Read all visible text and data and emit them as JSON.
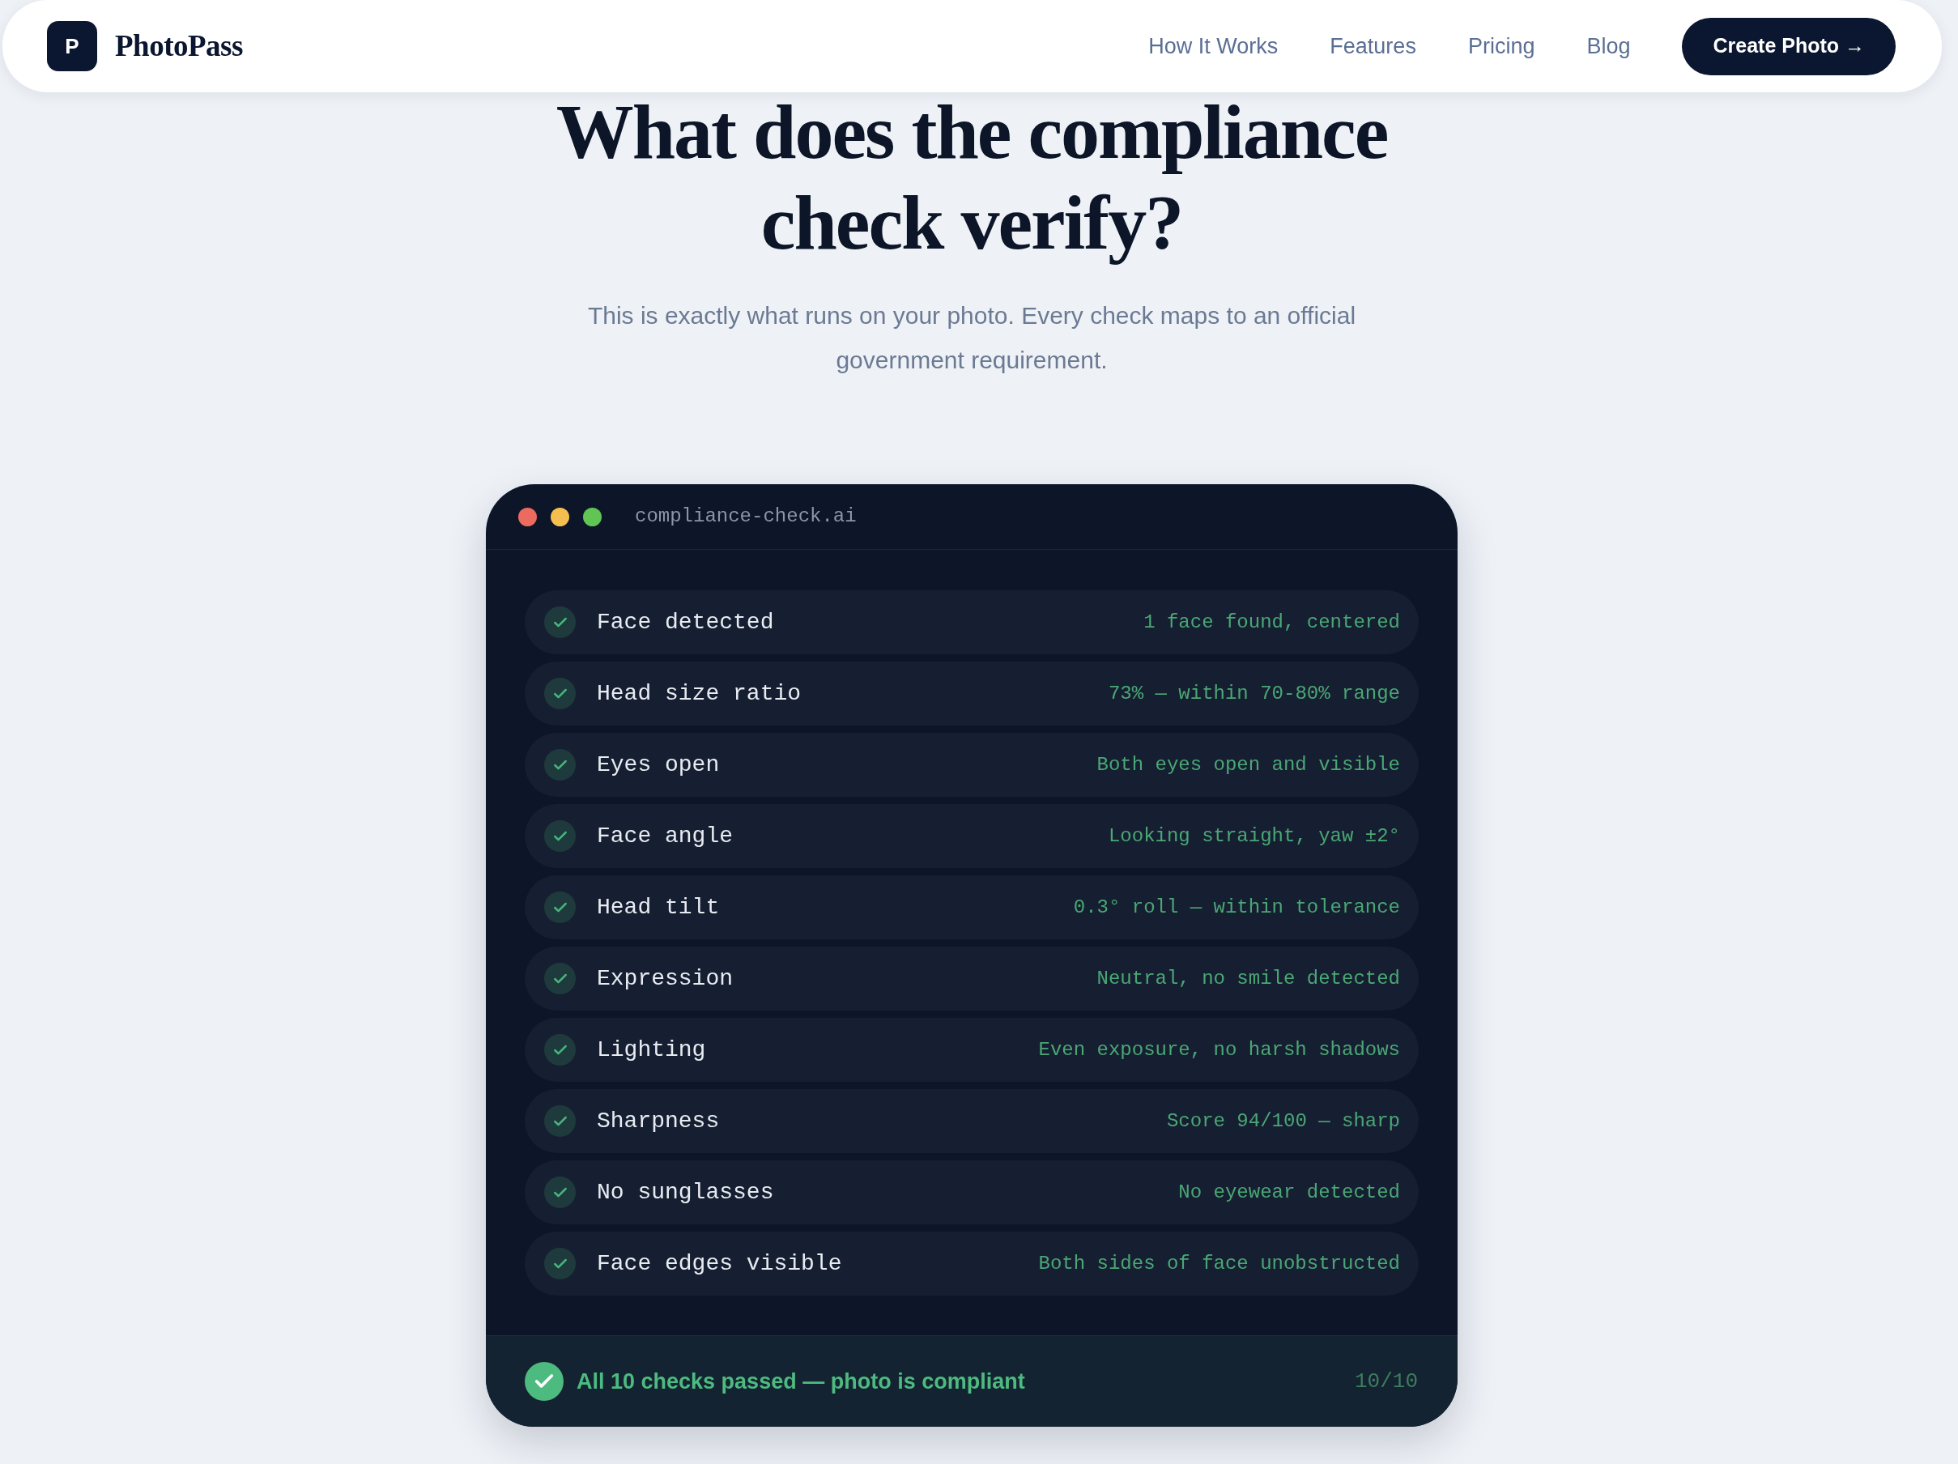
{
  "nav": {
    "logo_mark": "P",
    "brand": "PhotoPass",
    "links": [
      "How It Works",
      "Features",
      "Pricing",
      "Blog"
    ],
    "cta": "Create Photo →"
  },
  "hero": {
    "title": "What does the compliance check verify?",
    "subtitle": "This is exactly what runs on your photo. Every check maps to an official government requirement."
  },
  "terminal": {
    "title": "compliance-check.ai",
    "checks": [
      {
        "label": "Face detected",
        "result": "1 face found, centered",
        "passed": true
      },
      {
        "label": "Head size ratio",
        "result": "73% — within 70-80% range",
        "passed": true
      },
      {
        "label": "Eyes open",
        "result": "Both eyes open and visible",
        "passed": true
      },
      {
        "label": "Face angle",
        "result": "Looking straight, yaw ±2°",
        "passed": true
      },
      {
        "label": "Head tilt",
        "result": "0.3° roll — within tolerance",
        "passed": true
      },
      {
        "label": "Expression",
        "result": "Neutral, no smile detected",
        "passed": true
      },
      {
        "label": "Lighting",
        "result": "Even exposure, no harsh shadows",
        "passed": true
      },
      {
        "label": "Sharpness",
        "result": "Score 94/100 — sharp",
        "passed": true
      },
      {
        "label": "No sunglasses",
        "result": "No eyewear detected",
        "passed": true
      },
      {
        "label": "Face edges visible",
        "result": "Both sides of face unobstructed",
        "passed": true
      }
    ],
    "summary": {
      "text": "All 10 checks passed — photo is compliant",
      "passed": true,
      "score": "10/10"
    }
  }
}
